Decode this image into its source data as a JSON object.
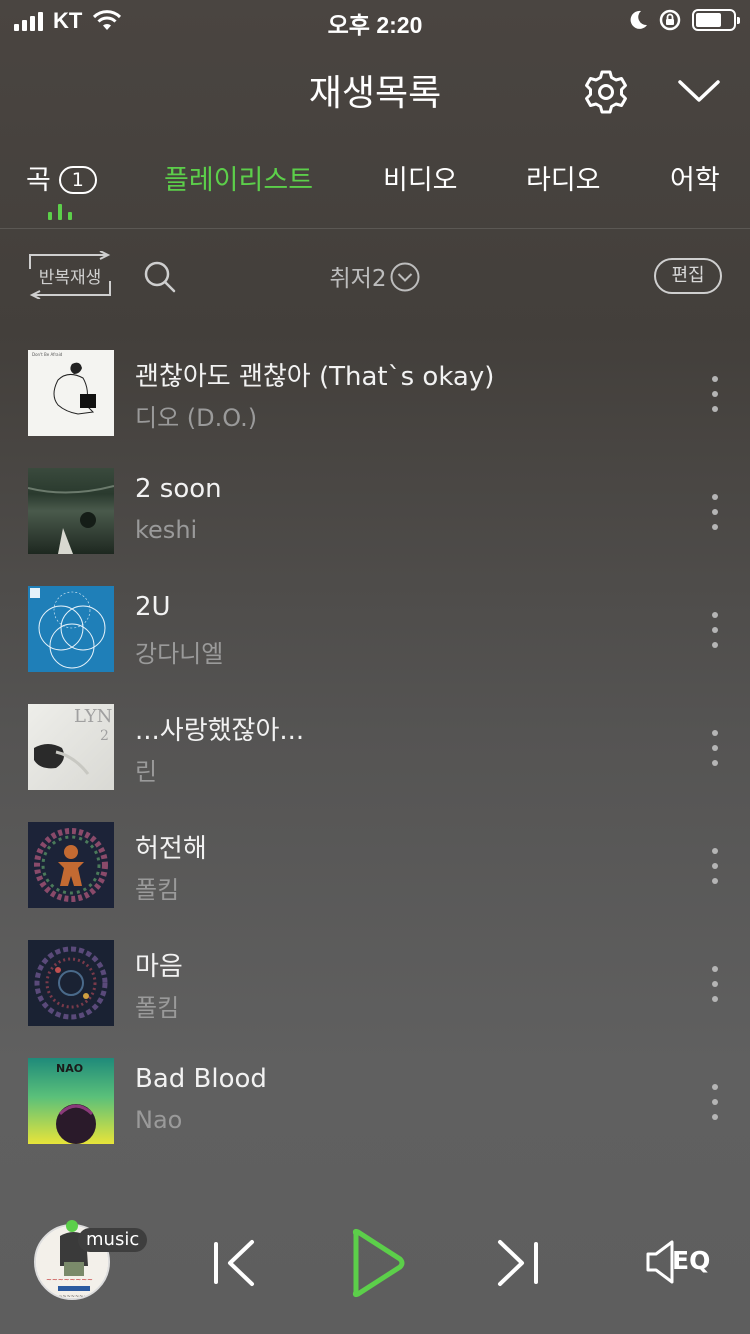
{
  "status_bar": {
    "carrier": "KT",
    "time": "오후 2:20"
  },
  "header": {
    "title": "재생목록"
  },
  "tabs": [
    {
      "label": "곡",
      "count": "1",
      "active": false
    },
    {
      "label": "플레이리스트",
      "active": true
    },
    {
      "label": "비디오",
      "active": false
    },
    {
      "label": "라디오",
      "active": false
    },
    {
      "label": "어학",
      "active": false
    }
  ],
  "toolbar": {
    "repeat_label": "반복재생",
    "playlist_name": "취저2",
    "edit_label": "편집"
  },
  "songs": [
    {
      "title": "괜찮아도 괜찮아 (That`s okay)",
      "artist": "디오 (D.O.)"
    },
    {
      "title": "2 soon",
      "artist": "keshi"
    },
    {
      "title": "2U",
      "artist": "강다니엘"
    },
    {
      "title": "...사랑했잖아...",
      "artist": "린"
    },
    {
      "title": "허전해",
      "artist": "폴킴"
    },
    {
      "title": "마음",
      "artist": "폴킴"
    },
    {
      "title": "Bad Blood",
      "artist": "Nao"
    }
  ],
  "player": {
    "source_tag": "music",
    "eq_label": "EQ"
  },
  "colors": {
    "accent": "#5ccf4a"
  }
}
